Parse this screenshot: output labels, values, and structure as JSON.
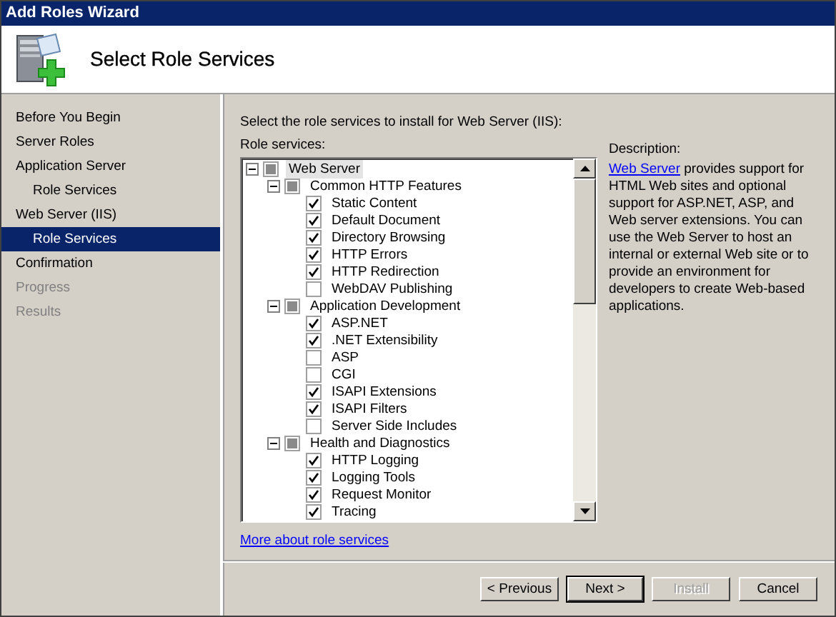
{
  "window": {
    "title": "Add Roles Wizard"
  },
  "header": {
    "title": "Select Role Services"
  },
  "sidebar": {
    "items": [
      {
        "label": "Before You Begin",
        "selected": false,
        "disabled": false
      },
      {
        "label": "Server Roles",
        "selected": false,
        "disabled": false
      },
      {
        "label": "Application Server",
        "selected": false,
        "disabled": false,
        "children": [
          {
            "label": "Role Services",
            "selected": false,
            "disabled": false
          }
        ]
      },
      {
        "label": "Web Server (IIS)",
        "selected": false,
        "disabled": false,
        "children": [
          {
            "label": "Role Services",
            "selected": true,
            "disabled": false
          }
        ]
      },
      {
        "label": "Confirmation",
        "selected": false,
        "disabled": false
      },
      {
        "label": "Progress",
        "selected": false,
        "disabled": true
      },
      {
        "label": "Results",
        "selected": false,
        "disabled": true
      }
    ]
  },
  "content": {
    "instruction": "Select the role services to install for Web Server (IIS):",
    "tree_label": "Role services:",
    "tree": [
      {
        "label": "Web Server",
        "partial": true,
        "expanded": true,
        "selected": true,
        "children": [
          {
            "label": "Common HTTP Features",
            "partial": true,
            "expanded": true,
            "selected": false,
            "children": [
              {
                "label": "Static Content",
                "checked": true,
                "selected": false
              },
              {
                "label": "Default Document",
                "checked": true,
                "selected": false
              },
              {
                "label": "Directory Browsing",
                "checked": true,
                "selected": false
              },
              {
                "label": "HTTP Errors",
                "checked": true,
                "selected": false
              },
              {
                "label": "HTTP Redirection",
                "checked": true,
                "selected": false
              },
              {
                "label": "WebDAV Publishing",
                "checked": false,
                "selected": false
              }
            ]
          },
          {
            "label": "Application Development",
            "partial": true,
            "expanded": true,
            "selected": false,
            "children": [
              {
                "label": "ASP.NET",
                "checked": true,
                "selected": false
              },
              {
                "label": ".NET Extensibility",
                "checked": true,
                "selected": false
              },
              {
                "label": "ASP",
                "checked": false,
                "selected": false
              },
              {
                "label": "CGI",
                "checked": false,
                "selected": false
              },
              {
                "label": "ISAPI Extensions",
                "checked": true,
                "selected": false
              },
              {
                "label": "ISAPI Filters",
                "checked": true,
                "selected": false
              },
              {
                "label": "Server Side Includes",
                "checked": false,
                "selected": false
              }
            ]
          },
          {
            "label": "Health and Diagnostics",
            "partial": true,
            "expanded": true,
            "selected": false,
            "children": [
              {
                "label": "HTTP Logging",
                "checked": true,
                "selected": false
              },
              {
                "label": "Logging Tools",
                "checked": true,
                "selected": false
              },
              {
                "label": "Request Monitor",
                "checked": true,
                "selected": false
              },
              {
                "label": "Tracing",
                "checked": true,
                "selected": false
              }
            ]
          }
        ]
      }
    ],
    "more_link": "More about role services",
    "description": {
      "label": "Description:",
      "link": "Web Server",
      "text": "provides support for HTML Web sites and optional support for ASP.NET, ASP, and Web server extensions. You can use the Web Server to host an internal or external Web site or to provide an environment for developers to create Web-based applications."
    }
  },
  "buttons": [
    {
      "label": "< Previous",
      "default": false,
      "disabled": false
    },
    {
      "label": "Next >",
      "default": true,
      "disabled": false
    },
    {
      "label": "Install",
      "default": false,
      "disabled": true
    },
    {
      "label": "Cancel",
      "default": false,
      "disabled": false
    }
  ]
}
